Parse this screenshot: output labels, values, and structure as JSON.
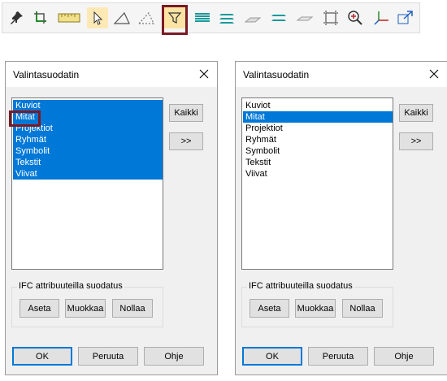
{
  "toolbar": {
    "icons": [
      "pin-icon",
      "crop-icon",
      "ruler-icon",
      "pointer-icon",
      "triangle-icon",
      "dashed-triangle-icon",
      "filter-icon",
      "layers-icon",
      "layers-stack-icon",
      "plane-icon",
      "layers-split-icon",
      "flat-plane-icon",
      "frame-icon",
      "zoom-in-icon",
      "axes-icon",
      "share-window-icon"
    ],
    "active_icon": "filter-icon",
    "highlight_color": "#7a1a24"
  },
  "dialog_left": {
    "title": "Valintasuodatin",
    "items": [
      "Kuviot",
      "Mitat",
      "Projektiot",
      "Ryhmät",
      "Symbolit",
      "Tekstit",
      "Viivat"
    ],
    "buttons": {
      "all": "Kaikki",
      "more": ">>",
      "ok": "OK",
      "cancel": "Peruuta",
      "help": "Ohje"
    },
    "ifc": {
      "label": "IFC attribuuteilla suodatus",
      "set": "Aseta",
      "edit": "Muokkaa",
      "reset": "Nollaa"
    }
  },
  "dialog_right": {
    "title": "Valintasuodatin",
    "items": [
      "Kuviot",
      "Mitat",
      "Projektiot",
      "Ryhmät",
      "Symbolit",
      "Tekstit",
      "Viivat"
    ],
    "buttons": {
      "all": "Kaikki",
      "more": ">>",
      "ok": "OK",
      "cancel": "Peruuta",
      "help": "Ohje"
    },
    "ifc": {
      "label": "IFC attribuuteilla suodatus",
      "set": "Aseta",
      "edit": "Muokkaa",
      "reset": "Nollaa"
    }
  },
  "colors": {
    "selection": "#0078d7",
    "accent": "#7a1a24"
  }
}
